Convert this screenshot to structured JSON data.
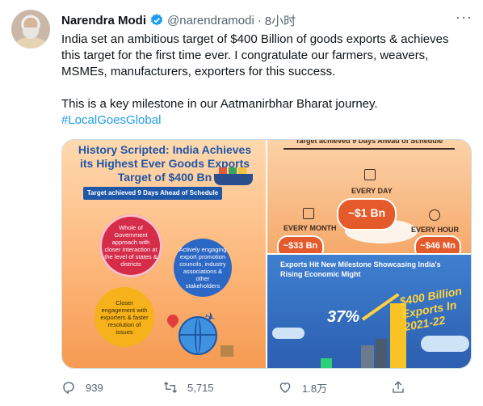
{
  "author": {
    "name": "Narendra Modi",
    "handle": "@narendramodi",
    "separator": "·",
    "time": "8小时"
  },
  "tweet": {
    "paragraph1": "India set an ambitious target of $400 Billion of goods exports & achieves this target for the first time ever. I congratulate our farmers, weavers, MSMEs, manufacturers, exporters for this success.",
    "paragraph2": "This is a key milestone in our Aatmanirbhar Bharat journey.",
    "hashtag": "#LocalGoesGlobal"
  },
  "media": {
    "image1": {
      "title": "History Scripted: India Achieves its Highest Ever Goods Exports Target of $400 Bn",
      "banner": "Target achieved 9 Days Ahead of Schedule",
      "bubble_red": "Whole of Government approach with closer interaction at the level of states & districts",
      "bubble_blue": "Actively engaging export promotion councils, industry associations & other stakeholders",
      "bubble_yellow": "Closer engagement with exporters & faster resolution of issues"
    },
    "image2": {
      "top": "Target achieved 9 Days Ahead of Schedule",
      "every_day": "EVERY DAY",
      "every_day_value": "~$1 Bn",
      "every_month": "EVERY MONTH",
      "every_month_value": "~$33 Bn",
      "every_hour": "EVERY HOUR",
      "every_hour_value": "~$46 Mn"
    },
    "image3": {
      "title": "Exports Hit New Milestone Showcasing India's Rising Economic Might",
      "percent": "37%",
      "big": "$400 Billion Exports In 2021-22"
    }
  },
  "actions": {
    "replies": "939",
    "retweets": "5,715",
    "likes": "1.8万"
  },
  "colors": {
    "link": "#1d9bf0",
    "muted": "#536471",
    "verified": "#1d9bf0"
  }
}
